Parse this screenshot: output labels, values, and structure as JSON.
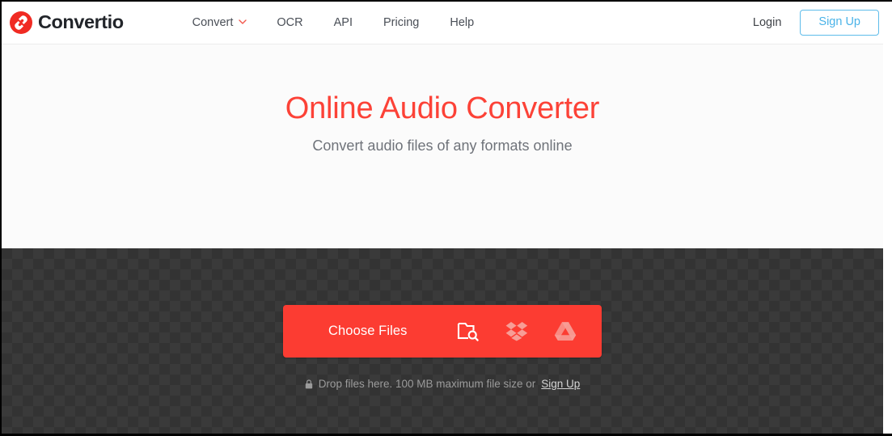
{
  "browser": {
    "scrollbar_visible": true
  },
  "header": {
    "logo": {
      "icon": "convertio-refresh-logo-icon",
      "text": "Convertio",
      "color": "#f02b23"
    },
    "nav": [
      {
        "label": "Convert",
        "has_dropdown": true,
        "dropdown_icon": "chevron-down-icon"
      },
      {
        "label": "OCR",
        "has_dropdown": false
      },
      {
        "label": "API",
        "has_dropdown": false
      },
      {
        "label": "Pricing",
        "has_dropdown": false
      },
      {
        "label": "Help",
        "has_dropdown": false
      }
    ],
    "login_label": "Login",
    "signup_label": "Sign Up",
    "signup_color": "#4ab3e8"
  },
  "hero": {
    "title": "Online Audio Converter",
    "title_color": "#fc4237",
    "subtitle": "Convert audio files of any formats online"
  },
  "dropzone": {
    "choose_files_label": "Choose Files",
    "button_color": "#fc3c32",
    "sources": [
      {
        "name": "local-files",
        "icon": "folder-search-icon",
        "color": "#ffffff"
      },
      {
        "name": "dropbox",
        "icon": "dropbox-icon",
        "color": "#f6a19a"
      },
      {
        "name": "google-drive",
        "icon": "google-drive-icon",
        "color": "#f6a19a"
      }
    ],
    "hint": {
      "lock_icon": "lock-icon",
      "text": "Drop files here. 100 MB maximum file size or",
      "signup_link": "Sign Up"
    }
  }
}
